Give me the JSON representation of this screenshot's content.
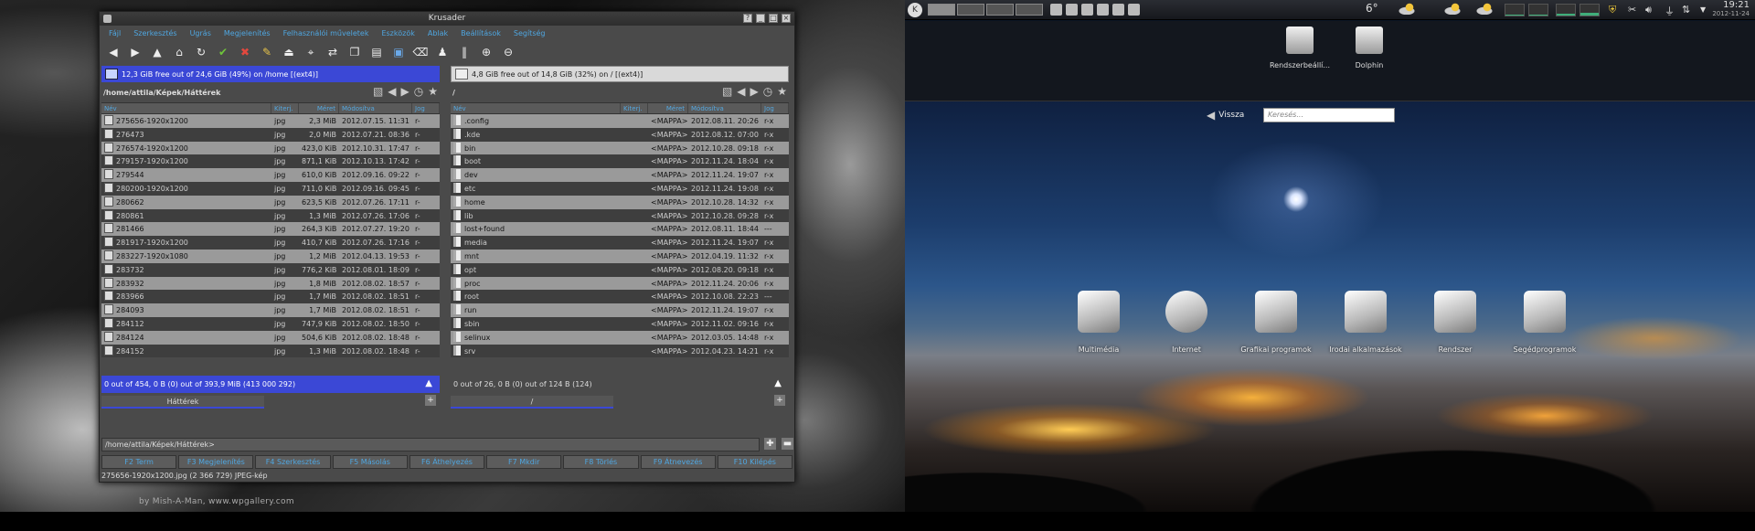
{
  "left_desktop": {
    "credit": "by Mish-A-Man, www.wpgallery.com"
  },
  "krusader": {
    "title": "Krusader",
    "menu": [
      "Fájl",
      "Szerkesztés",
      "Ugrás",
      "Megjelenítés",
      "Felhasználói műveletek",
      "Eszközök",
      "Ablak",
      "Beállítások",
      "Segítség"
    ],
    "left": {
      "space": "12,3 GiB free out of 24,6 GiB (49%) on /home [(ext4)]",
      "path": "/home/attila/Képek/Háttérek",
      "columns": [
        "Név",
        "Kiterj.",
        "Méret",
        "Módosítva",
        "Jog"
      ],
      "rows": [
        {
          "name": "275656-1920x1200",
          "ext": "jpg",
          "size": "2,3 MiB",
          "date": "2012.07.15. 11:31",
          "perm": "r-"
        },
        {
          "name": "276473",
          "ext": "jpg",
          "size": "2,0 MiB",
          "date": "2012.07.21. 08:36",
          "perm": "r-"
        },
        {
          "name": "276574-1920x1200",
          "ext": "jpg",
          "size": "423,0 KiB",
          "date": "2012.10.31. 17:47",
          "perm": "r-"
        },
        {
          "name": "279157-1920x1200",
          "ext": "jpg",
          "size": "871,1 KiB",
          "date": "2012.10.13. 17:42",
          "perm": "r-"
        },
        {
          "name": "279544",
          "ext": "jpg",
          "size": "610,0 KiB",
          "date": "2012.09.16. 09:22",
          "perm": "r-"
        },
        {
          "name": "280200-1920x1200",
          "ext": "jpg",
          "size": "711,0 KiB",
          "date": "2012.09.16. 09:45",
          "perm": "r-"
        },
        {
          "name": "280662",
          "ext": "jpg",
          "size": "623,5 KiB",
          "date": "2012.07.26. 17:11",
          "perm": "r-"
        },
        {
          "name": "280861",
          "ext": "jpg",
          "size": "1,3 MiB",
          "date": "2012.07.26. 17:06",
          "perm": "r-"
        },
        {
          "name": "281466",
          "ext": "jpg",
          "size": "264,3 KiB",
          "date": "2012.07.27. 19:20",
          "perm": "r-"
        },
        {
          "name": "281917-1920x1200",
          "ext": "jpg",
          "size": "410,7 KiB",
          "date": "2012.07.26. 17:16",
          "perm": "r-"
        },
        {
          "name": "283227-1920x1080",
          "ext": "jpg",
          "size": "1,2 MiB",
          "date": "2012.04.13. 19:53",
          "perm": "r-"
        },
        {
          "name": "283732",
          "ext": "jpg",
          "size": "776,2 KiB",
          "date": "2012.08.01. 18:09",
          "perm": "r-"
        },
        {
          "name": "283932",
          "ext": "jpg",
          "size": "1,8 MiB",
          "date": "2012.08.02. 18:57",
          "perm": "r-"
        },
        {
          "name": "283966",
          "ext": "jpg",
          "size": "1,7 MiB",
          "date": "2012.08.02. 18:51",
          "perm": "r-"
        },
        {
          "name": "284093",
          "ext": "jpg",
          "size": "1,7 MiB",
          "date": "2012.08.02. 18:51",
          "perm": "r-"
        },
        {
          "name": "284112",
          "ext": "jpg",
          "size": "747,9 KiB",
          "date": "2012.08.02. 18:50",
          "perm": "r-"
        },
        {
          "name": "284124",
          "ext": "jpg",
          "size": "504,6 KiB",
          "date": "2012.08.02. 18:48",
          "perm": "r-"
        },
        {
          "name": "284152",
          "ext": "jpg",
          "size": "1,3 MiB",
          "date": "2012.08.02. 18:48",
          "perm": "r-"
        }
      ],
      "status": "0 out of 454, 0 B (0) out of 393,9 MiB (413 000 292)",
      "tab": "Háttérek"
    },
    "right": {
      "space": "4,8 GiB free out of 14,8 GiB (32%) on / [(ext4)]",
      "path": "/",
      "columns": [
        "Név",
        "Kiterj.",
        "Méret",
        "Módosítva",
        "Jog"
      ],
      "rows": [
        {
          "name": ".config",
          "size": "<MAPPA>",
          "date": "2012.08.11. 20:26",
          "perm": "r-x"
        },
        {
          "name": ".kde",
          "size": "<MAPPA>",
          "date": "2012.08.12. 07:00",
          "perm": "r-x"
        },
        {
          "name": "bin",
          "size": "<MAPPA>",
          "date": "2012.10.28. 09:18",
          "perm": "r-x"
        },
        {
          "name": "boot",
          "size": "<MAPPA>",
          "date": "2012.11.24. 18:04",
          "perm": "r-x"
        },
        {
          "name": "dev",
          "size": "<MAPPA>",
          "date": "2012.11.24. 19:07",
          "perm": "r-x"
        },
        {
          "name": "etc",
          "size": "<MAPPA>",
          "date": "2012.11.24. 19:08",
          "perm": "r-x"
        },
        {
          "name": "home",
          "size": "<MAPPA>",
          "date": "2012.10.28. 14:32",
          "perm": "r-x"
        },
        {
          "name": "lib",
          "size": "<MAPPA>",
          "date": "2012.10.28. 09:28",
          "perm": "r-x"
        },
        {
          "name": "lost+found",
          "size": "<MAPPA>",
          "date": "2012.08.11. 18:44",
          "perm": "---"
        },
        {
          "name": "media",
          "size": "<MAPPA>",
          "date": "2012.11.24. 19:07",
          "perm": "r-x"
        },
        {
          "name": "mnt",
          "size": "<MAPPA>",
          "date": "2012.04.19. 11:32",
          "perm": "r-x"
        },
        {
          "name": "opt",
          "size": "<MAPPA>",
          "date": "2012.08.20. 09:18",
          "perm": "r-x"
        },
        {
          "name": "proc",
          "size": "<MAPPA>",
          "date": "2012.11.24. 20:06",
          "perm": "r-x"
        },
        {
          "name": "root",
          "size": "<MAPPA>",
          "date": "2012.10.08. 22:23",
          "perm": "---"
        },
        {
          "name": "run",
          "size": "<MAPPA>",
          "date": "2012.11.24. 19:07",
          "perm": "r-x"
        },
        {
          "name": "sbin",
          "size": "<MAPPA>",
          "date": "2012.11.02. 09:16",
          "perm": "r-x"
        },
        {
          "name": "selinux",
          "size": "<MAPPA>",
          "date": "2012.03.05. 14:48",
          "perm": "r-x"
        },
        {
          "name": "srv",
          "size": "<MAPPA>",
          "date": "2012.04.23. 14:21",
          "perm": "r-x"
        }
      ],
      "status": "0 out of 26, 0 B (0) out of 124 B (124)",
      "tab": "/"
    },
    "cmdline": "/home/attila/Képek/Háttérek>",
    "fkeys": [
      "F2 Term",
      "F3 Megjelenítés",
      "F4 Szerkesztés",
      "F5 Másolás",
      "F6 Áthelyezés",
      "F7 Mkdir",
      "F8 Törlés",
      "F9 Átnevezés",
      "F10 Kilépés"
    ],
    "statusline": "275656-1920x1200.jpg (2 366 729)  JPEG-kép"
  },
  "desktop": {
    "temperature": "6°",
    "clock_time": "19:21",
    "clock_date": "2012-11-24",
    "favorites": [
      {
        "label": "Rendszerbeállí..."
      },
      {
        "label": "Dolphin"
      }
    ],
    "back_label": "Vissza",
    "search_placeholder": "Keresés...",
    "categories": [
      "Multimédia",
      "Internet",
      "Grafikai programok",
      "Irodai alkalmazások",
      "Rendszer",
      "Segédprogramok"
    ]
  }
}
